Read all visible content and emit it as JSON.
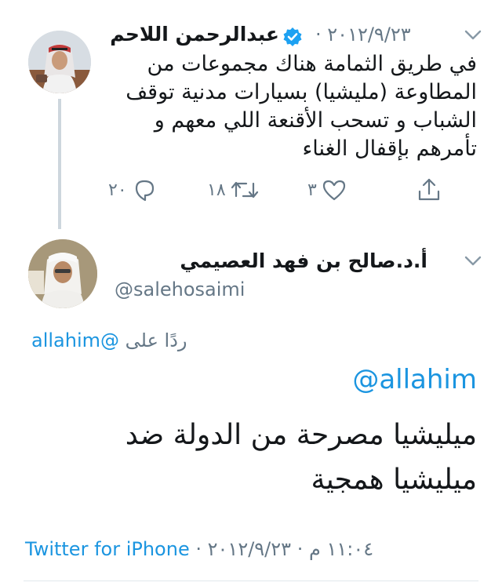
{
  "parent_tweet": {
    "display_name": "عبدالرحمن اللاحم",
    "date": "٢٠١٢/٩/٢٣",
    "separator": "·",
    "text": "في طريق الثمامة هناك مجموعات من المطاوعة (مليشيا) بسيارات مدنية توقف الشباب و تسحب الأقنعة اللي معهم و تأمرهم بإقفال الغناء",
    "actions": {
      "replies": "٢٠",
      "retweets": "١٨",
      "likes": "٣"
    },
    "icons": {
      "verified": "verified-badge-icon",
      "menu": "chevron-down-icon",
      "reply": "reply-icon",
      "retweet": "retweet-icon",
      "like": "heart-icon",
      "share": "share-icon"
    }
  },
  "main_tweet": {
    "display_name": "أ.د.صالح بن فهد العصيمي",
    "handle": "@salehosaimi",
    "replying_prefix": "ردًا على",
    "replying_to": "@allahim",
    "mention": "@allahim",
    "text": "ميليشيا مصرحة من الدولة ضد ميليشيا همجية",
    "footer": {
      "time": "١١:٠٤ م",
      "separator1": "·",
      "date": "٢٠١٢/٩/٢٣",
      "separator2": "·",
      "source": "Twitter for iPhone"
    }
  },
  "colors": {
    "link": "#1b95e0",
    "secondary": "#657786",
    "primary_text": "#14171a",
    "verified": "#1da1f2",
    "divider": "#e1e8ed"
  }
}
